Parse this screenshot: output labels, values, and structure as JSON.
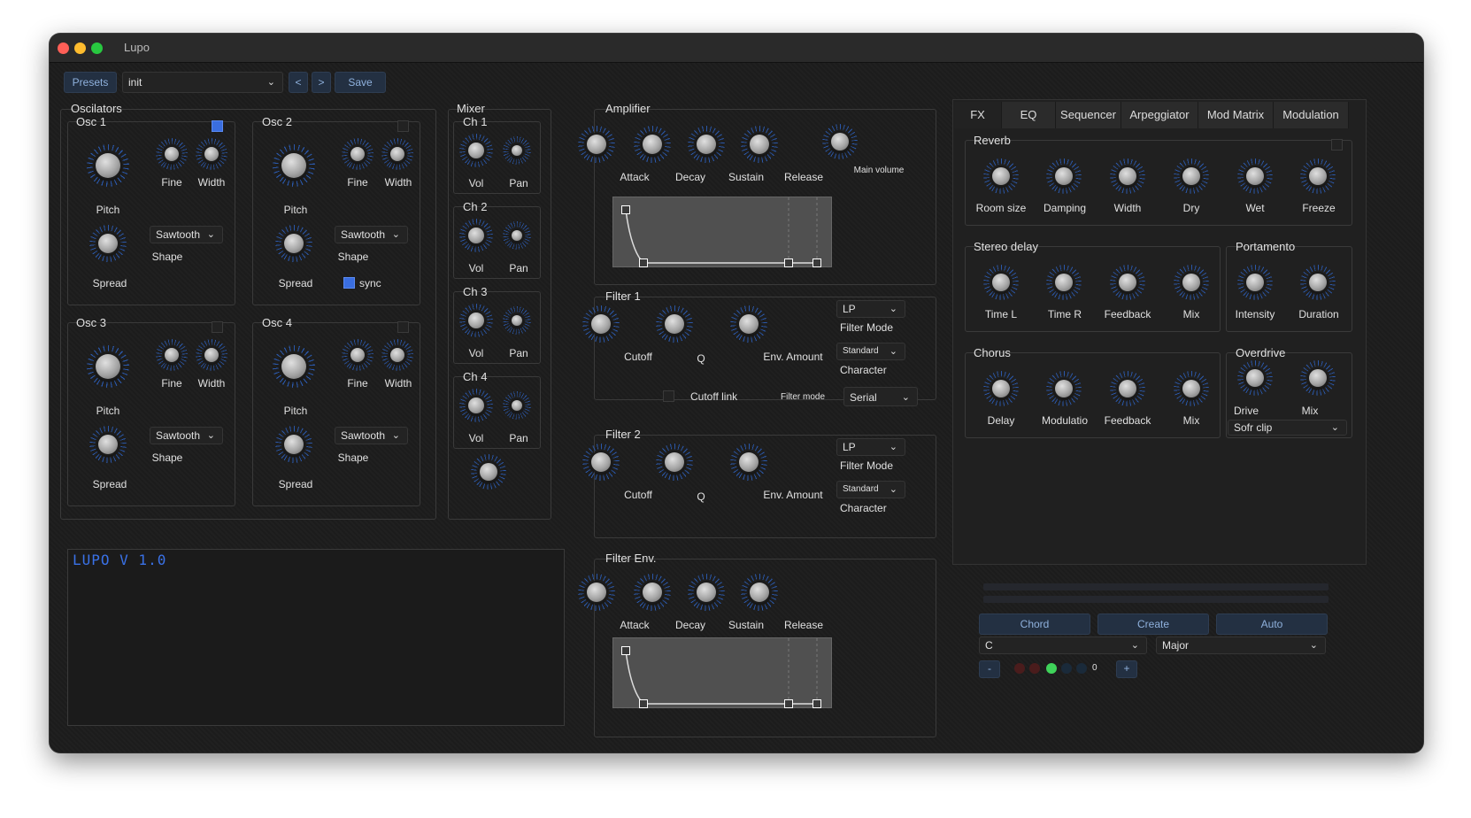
{
  "window": {
    "title": "Lupo"
  },
  "presets": {
    "button": "Presets",
    "current": "init",
    "prev": "<",
    "next": ">",
    "save": "Save"
  },
  "oscillators": {
    "title": "Oscilators",
    "osc1": {
      "title": "Osc 1",
      "pitch": "Pitch",
      "fine": "Fine",
      "width": "Width",
      "spread": "Spread",
      "shape_label": "Shape",
      "shape": "Sawtooth"
    },
    "osc2": {
      "title": "Osc 2",
      "pitch": "Pitch",
      "fine": "Fine",
      "width": "Width",
      "spread": "Spread",
      "shape_label": "Shape",
      "shape": "Sawtooth",
      "sync": "sync"
    },
    "osc3": {
      "title": "Osc 3",
      "pitch": "Pitch",
      "fine": "Fine",
      "width": "Width",
      "spread": "Spread",
      "shape_label": "Shape",
      "shape": "Sawtooth"
    },
    "osc4": {
      "title": "Osc 4",
      "pitch": "Pitch",
      "fine": "Fine",
      "width": "Width",
      "spread": "Spread",
      "shape_label": "Shape",
      "shape": "Sawtooth"
    }
  },
  "mixer": {
    "title": "Mixer",
    "ch1": {
      "title": "Ch 1",
      "vol": "Vol",
      "pan": "Pan"
    },
    "ch2": {
      "title": "Ch 2",
      "vol": "Vol",
      "pan": "Pan"
    },
    "ch3": {
      "title": "Ch 3",
      "vol": "Vol",
      "pan": "Pan"
    },
    "ch4": {
      "title": "Ch 4",
      "vol": "Vol",
      "pan": "Pan"
    }
  },
  "display": {
    "logo": "LUPO V 1.0"
  },
  "amplifier": {
    "title": "Amplifier",
    "attack": "Attack",
    "decay": "Decay",
    "sustain": "Sustain",
    "release": "Release",
    "main_volume": "Main volume"
  },
  "filter1": {
    "title": "Filter 1",
    "cutoff": "Cutoff",
    "q": "Q",
    "env_amount": "Env. Amount",
    "mode": "LP",
    "mode_label": "Filter Mode",
    "character": "Standard",
    "character_label": "Character"
  },
  "filter_link": {
    "cutoff_link": "Cutoff link",
    "filter_mode_label": "Filter mode",
    "filter_mode": "Serial"
  },
  "filter2": {
    "title": "Filter 2",
    "cutoff": "Cutoff",
    "q": "Q",
    "env_amount": "Env. Amount",
    "mode": "LP",
    "mode_label": "Filter Mode",
    "character": "Standard",
    "character_label": "Character"
  },
  "filter_env": {
    "title": "Filter Env.",
    "attack": "Attack",
    "decay": "Decay",
    "sustain": "Sustain",
    "release": "Release"
  },
  "tabs": [
    "FX",
    "EQ",
    "Sequencer",
    "Arpeggiator",
    "Mod Matrix",
    "Modulation"
  ],
  "fx": {
    "reverb": {
      "title": "Reverb",
      "room_size": "Room size",
      "damping": "Damping",
      "width": "Width",
      "dry": "Dry",
      "wet": "Wet",
      "freeze": "Freeze"
    },
    "stereo_delay": {
      "title": "Stereo delay",
      "time_l": "Time L",
      "time_r": "Time R",
      "feedback": "Feedback",
      "mix": "Mix"
    },
    "portamento": {
      "title": "Portamento",
      "intensity": "Intensity",
      "duration": "Duration"
    },
    "chorus": {
      "title": "Chorus",
      "delay": "Delay",
      "modulation": "Modulatio",
      "feedback": "Feedback",
      "mix": "Mix"
    },
    "overdrive": {
      "title": "Overdrive",
      "drive": "Drive",
      "mix": "Mix",
      "mode": "Sofr clip"
    }
  },
  "chord": {
    "chord": "Chord",
    "create": "Create",
    "auto": "Auto",
    "key": "C",
    "scale": "Major",
    "minus": "-",
    "plus": "+",
    "count": "0"
  },
  "colors": {
    "accent_blue": "#3a6ee0",
    "ring_blue": "#2f6bd8",
    "green_led": "#3fd35a",
    "red_led": "#4a1c1c"
  }
}
